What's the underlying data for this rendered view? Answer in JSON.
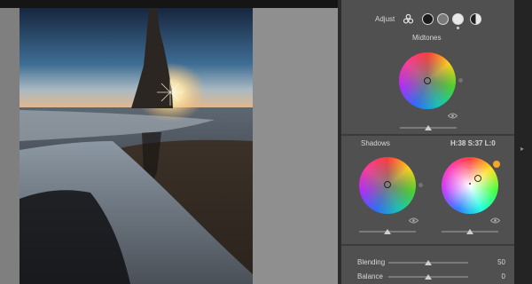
{
  "adjust": {
    "label": "Adjust",
    "modes": [
      {
        "icon": "three-wheels-icon",
        "selected": true
      },
      {
        "icon": "shadows-circle-icon",
        "selected": false
      },
      {
        "icon": "midtones-circle-icon",
        "selected": false
      },
      {
        "icon": "highlights-circle-icon",
        "selected": false
      },
      {
        "icon": "global-circle-icon",
        "selected": false
      }
    ]
  },
  "midtones": {
    "label": "Midtones",
    "luminance": 0.5
  },
  "shadows": {
    "label": "Shadows",
    "luminance": 0.5
  },
  "highlights": {
    "readout": "H:38 S:37 L:0",
    "luminance": 0.5,
    "swatch_color": "#f5a623"
  },
  "blending": {
    "label": "Blending",
    "value": "50",
    "position": 0.5
  },
  "balance": {
    "label": "Balance",
    "value": "0",
    "position": 0.5
  },
  "colors": {
    "panel": "#505050",
    "canvas": "#8f8f8f",
    "accent": "#f5a623"
  }
}
